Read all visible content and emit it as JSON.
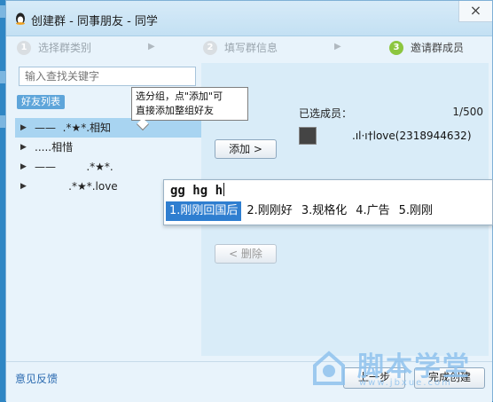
{
  "window": {
    "title": "创建群 - 同事朋友 - 同学",
    "close_glyph": "×"
  },
  "steps": [
    {
      "num": "1",
      "label": "选择群类别"
    },
    {
      "num": "2",
      "label": "填写群信息"
    },
    {
      "num": "3",
      "label": "邀请群成员"
    }
  ],
  "step_arrow": "▶",
  "search": {
    "placeholder": "输入查找关键字"
  },
  "friend_list_tag": "好友列表",
  "tooltip": {
    "line1": "选分组，点\"添加\"可",
    "line2": "直接添加整组好友"
  },
  "groups": [
    {
      "label": "——  .*★*.相知",
      "selected": true
    },
    {
      "label": ".....相惜",
      "selected": false
    },
    {
      "label": "——         .*★*.",
      "selected": false
    },
    {
      "label": "          .*★*.love",
      "selected": false
    }
  ],
  "expand_glyph": "▶",
  "buttons": {
    "add": "添加 >",
    "remove": "< 删除",
    "prev": "上一步",
    "finish": "完成创建"
  },
  "selected_members": {
    "label": "已选成员：",
    "count": "1/500",
    "members": [
      {
        "name": ".ıl·ı†love(2318944632)"
      }
    ]
  },
  "ime": {
    "input": "gg hg h",
    "candidates": [
      "1.刚刚回国后",
      "2.刚刚好",
      "3.规格化",
      "4.广告",
      "5.刚刚"
    ]
  },
  "feedback_link": "意见反馈",
  "watermark": {
    "text": "脚本学堂",
    "sub": "www.jbxue.com"
  },
  "colors": {
    "accent": "#2f86c4",
    "selection": "#a8d4f1",
    "step_active": "#8cc63f",
    "ime_highlight": "#2f7ed0"
  }
}
